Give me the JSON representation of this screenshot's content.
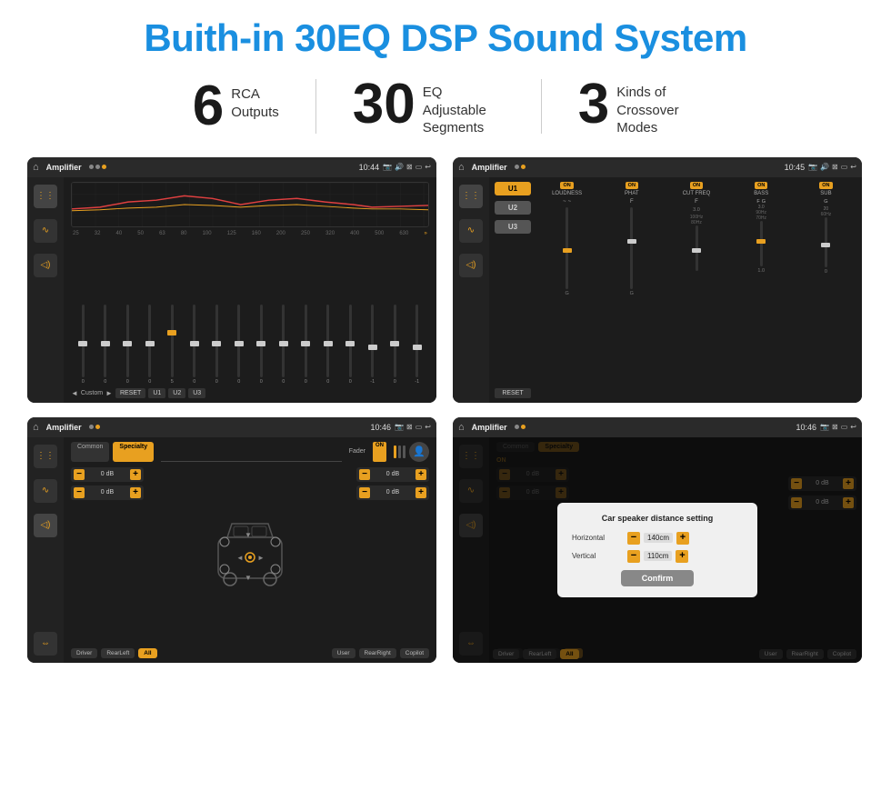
{
  "title": "Buith-in 30EQ DSP Sound System",
  "stats": [
    {
      "number": "6",
      "text": "RCA\nOutputs"
    },
    {
      "number": "30",
      "text": "EQ Adjustable\nSegments"
    },
    {
      "number": "3",
      "text": "Kinds of\nCrossover Modes"
    }
  ],
  "screens": [
    {
      "id": "screen-eq",
      "title": "Amplifier",
      "time": "10:44",
      "type": "eq"
    },
    {
      "id": "screen-crossover",
      "title": "Amplifier",
      "time": "10:45",
      "type": "crossover"
    },
    {
      "id": "screen-fader",
      "title": "Amplifier",
      "time": "10:46",
      "type": "fader"
    },
    {
      "id": "screen-dialog",
      "title": "Amplifier",
      "time": "10:46",
      "type": "dialog"
    }
  ],
  "eq": {
    "freqs": [
      "25",
      "32",
      "40",
      "50",
      "63",
      "80",
      "100",
      "125",
      "160",
      "200",
      "250",
      "320",
      "400",
      "500",
      "630"
    ],
    "values": [
      "0",
      "0",
      "0",
      "0",
      "5",
      "0",
      "0",
      "0",
      "0",
      "0",
      "0",
      "0",
      "0",
      "-1",
      "0",
      "-1"
    ],
    "buttons": [
      "Custom",
      "RESET",
      "U1",
      "U2",
      "U3"
    ]
  },
  "crossover": {
    "u_buttons": [
      "U1",
      "U2",
      "U3"
    ],
    "channels": [
      "LOUDNESS",
      "PHAT",
      "CUT FREQ",
      "BASS",
      "SUB"
    ],
    "on_label": "ON",
    "reset_label": "RESET"
  },
  "fader": {
    "tabs": [
      "Common",
      "Specialty"
    ],
    "active_tab": "Specialty",
    "fader_label": "Fader",
    "on_label": "ON",
    "db_values": [
      "0 dB",
      "0 dB",
      "0 dB",
      "0 dB"
    ],
    "bottom_buttons": [
      "Driver",
      "RearLeft",
      "All",
      "User",
      "RearRight",
      "Copilot"
    ]
  },
  "dialog": {
    "title": "Car speaker distance setting",
    "horizontal_label": "Horizontal",
    "horizontal_value": "140cm",
    "vertical_label": "Vertical",
    "vertical_value": "110cm",
    "confirm_label": "Confirm",
    "minus_label": "−",
    "plus_label": "+"
  }
}
